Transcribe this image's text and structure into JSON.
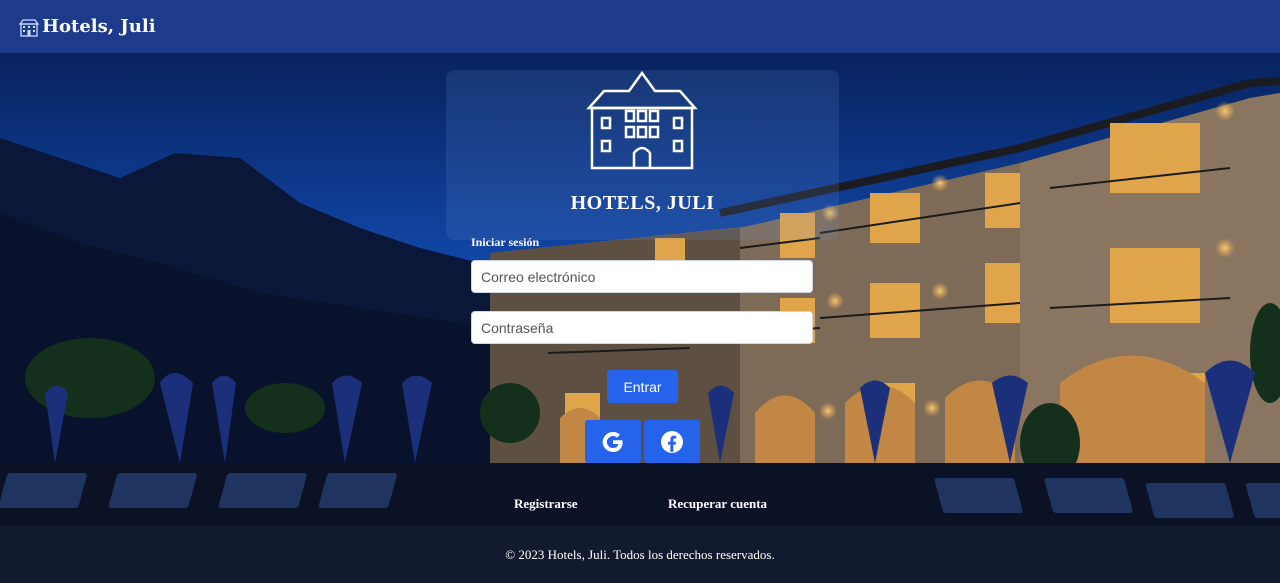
{
  "navbar": {
    "brand": "Hotels, Juli",
    "brand_icon": "hotel-building-icon"
  },
  "login": {
    "title": "HOTELS, JULI",
    "logo_icon": "hotel-building-icon",
    "section_label": "Iniciar sesión",
    "email_placeholder": "Correo electrónico",
    "password_placeholder": "Contraseña",
    "submit_label": "Entrar",
    "social": [
      {
        "name": "google",
        "icon": "google-icon"
      },
      {
        "name": "facebook",
        "icon": "facebook-icon"
      }
    ],
    "register_link": "Registrarse",
    "recover_link": "Recuperar cuenta"
  },
  "footer": {
    "copyright": "© 2023 Hotels, Juli. Todos los derechos reservados."
  },
  "colors": {
    "navbar": "#1e3a8a",
    "primary_button": "#2563eb",
    "footer": "#111a2e"
  }
}
